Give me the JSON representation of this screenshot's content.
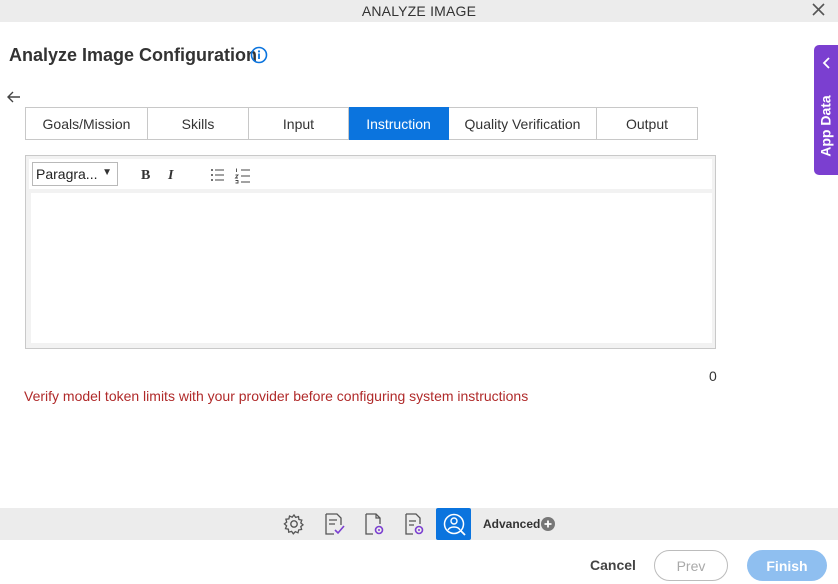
{
  "window": {
    "title": "ANALYZE IMAGE",
    "close_icon": "close-icon"
  },
  "header": {
    "title": "Analyze Image Configuration",
    "info_icon": "info-icon"
  },
  "nav": {
    "back_icon": "arrow-left-icon"
  },
  "tabs": [
    {
      "label": "Goals/Mission",
      "active": false
    },
    {
      "label": "Skills",
      "active": false
    },
    {
      "label": "Input",
      "active": false
    },
    {
      "label": "Instruction",
      "active": true
    },
    {
      "label": "Quality Verification",
      "active": false
    },
    {
      "label": "Output",
      "active": false
    }
  ],
  "editor": {
    "format_select": "Paragra...",
    "bold_label": "B",
    "italic_label": "I",
    "bullet_list_icon": "bulleted-list-icon",
    "numbered_list_icon": "numbered-list-icon",
    "content": "",
    "char_count": "0"
  },
  "warning": "Verify model token limits with your provider before configuring system instructions",
  "bottom_toolbar": {
    "icons": [
      "gear-icon",
      "document-check-icon",
      "document-settings-icon",
      "document-config-icon",
      "image-analysis-icon"
    ],
    "active_icon": "image-analysis-icon",
    "advanced_label": "Advanced",
    "advanced_icon": "plus-circle-icon"
  },
  "footer": {
    "cancel_label": "Cancel",
    "prev_label": "Prev",
    "finish_label": "Finish"
  },
  "side_panel": {
    "label": "App Data",
    "chevron_icon": "chevron-left-icon"
  },
  "colors": {
    "accent": "#0b74de",
    "app_data": "#7b3fd0",
    "warning": "#b02a2a",
    "finish_disabled": "#8fbff0"
  }
}
